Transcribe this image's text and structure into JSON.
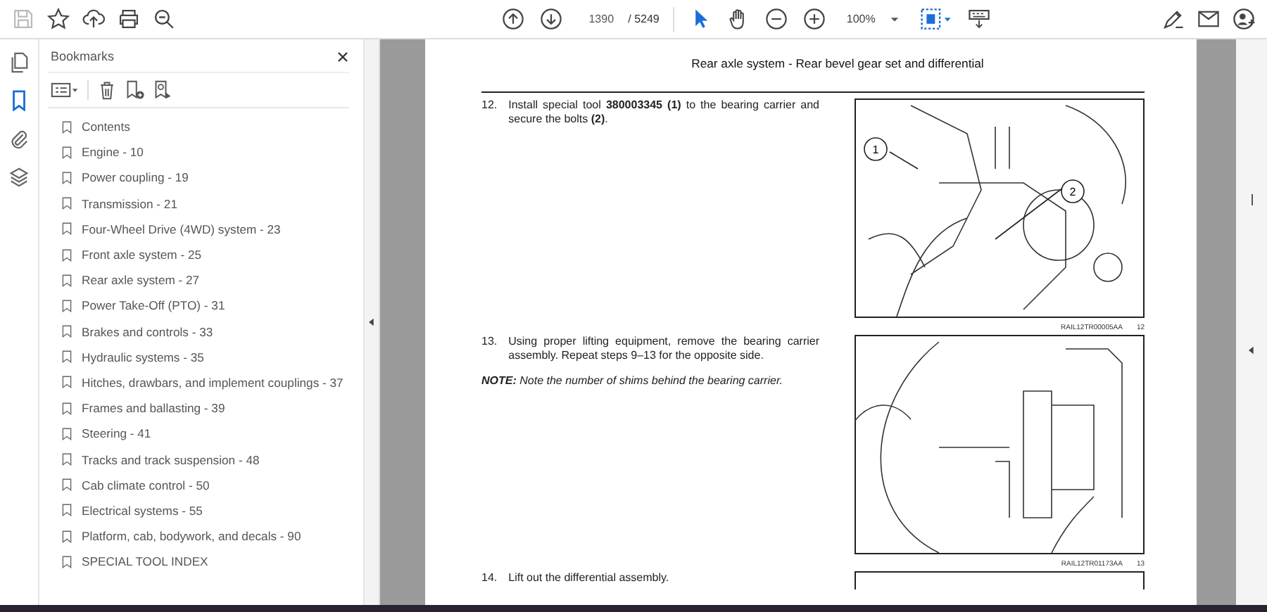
{
  "toolbar": {
    "page_number": "1390",
    "page_total": "/ 5249",
    "zoom": "100%",
    "tools": [
      {
        "kind": "select",
        "selected": true
      },
      {
        "kind": "hand",
        "selected": false
      }
    ]
  },
  "side_rail": [
    {
      "kind": "pages",
      "selected": false
    },
    {
      "kind": "bookmarks",
      "selected": true
    },
    {
      "kind": "attachments",
      "selected": false
    },
    {
      "kind": "layers",
      "selected": false
    }
  ],
  "bookmarks": {
    "title": "Bookmarks",
    "items": [
      {
        "label": "Contents"
      },
      {
        "label": "Engine - 10"
      },
      {
        "label": "Power coupling - 19"
      },
      {
        "label": "Transmission - 21"
      },
      {
        "label": "Four-Wheel Drive (4WD) system - 23"
      },
      {
        "label": "Front axle system - 25"
      },
      {
        "label": "Rear axle system - 27"
      },
      {
        "label": "Power Take-Off (PTO) - 31"
      },
      {
        "label": "Brakes and controls - 33"
      },
      {
        "label": "Hydraulic systems - 35"
      },
      {
        "label": "Hitches, drawbars, and implement couplings - 37"
      },
      {
        "label": "Frames and ballasting - 39"
      },
      {
        "label": "Steering - 41"
      },
      {
        "label": "Tracks and track suspension - 48"
      },
      {
        "label": "Cab climate control - 50"
      },
      {
        "label": "Electrical systems - 55"
      },
      {
        "label": "Platform, cab, bodywork, and decals - 90"
      },
      {
        "label": "SPECIAL TOOL INDEX"
      }
    ]
  },
  "document": {
    "header": "Rear axle system - Rear bevel gear set and differential",
    "steps": [
      {
        "number": "12.",
        "text": "Install special tool **380003345 (1)** to the bearing carrier and secure the bolts **(2)**.",
        "figure": {
          "callouts": [
            "1",
            "2"
          ],
          "code": "RAIL12TR00005AA",
          "number": "12"
        }
      },
      {
        "number": "13.",
        "text": "Using proper lifting equipment, remove the bearing carrier assembly. Repeat steps 9–13 for the opposite side.",
        "note": "**NOTE:** Note the number of shims behind the bearing carrier.",
        "figure": {
          "code": "RAIL12TR01173AA",
          "number": "13"
        }
      },
      {
        "number": "14.",
        "text": "Lift out the differential assembly."
      }
    ]
  }
}
